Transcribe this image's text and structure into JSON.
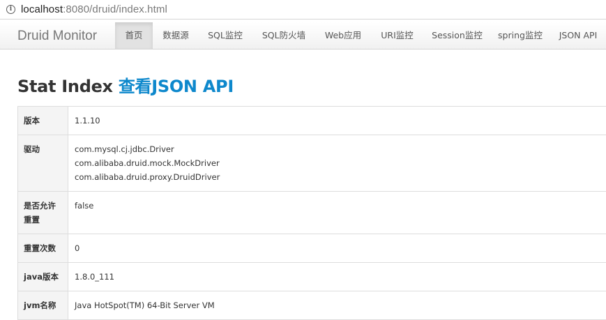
{
  "browser": {
    "url_host": "localhost",
    "url_path": ":8080/druid/index.html"
  },
  "navbar": {
    "brand": "Druid Monitor",
    "items": [
      {
        "label": "首页",
        "active": true
      },
      {
        "label": "数据源"
      },
      {
        "label": "SQL监控"
      },
      {
        "label": "SQL防火墙"
      },
      {
        "label": "Web应用"
      },
      {
        "label": "URI监控"
      },
      {
        "label": "Session监控"
      },
      {
        "label": "spring监控"
      },
      {
        "label": "JSON API"
      }
    ]
  },
  "page": {
    "title": "Stat Index",
    "json_link": "查看JSON API"
  },
  "stat_table": {
    "rows": [
      {
        "key": "版本",
        "value": "1.1.10"
      },
      {
        "key": "驱动",
        "values": [
          "com.mysql.cj.jdbc.Driver",
          "com.alibaba.druid.mock.MockDriver",
          "com.alibaba.druid.proxy.DruidDriver"
        ]
      },
      {
        "key": "是否允许重置",
        "value": "false"
      },
      {
        "key": "重置次数",
        "value": "0"
      },
      {
        "key": "java版本",
        "value": "1.8.0_111"
      },
      {
        "key": "jvm名称",
        "value": "Java HotSpot(TM) 64-Bit Server VM"
      }
    ]
  }
}
